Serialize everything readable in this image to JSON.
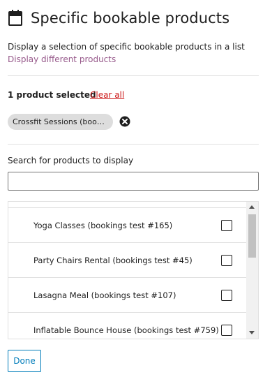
{
  "header": {
    "icon": "calendar-icon",
    "title": "Specific bookable products"
  },
  "description": "Display a selection of specific bookable products in a list",
  "change_link": "Display different products",
  "selection": {
    "count_label": "1 product selected",
    "clear_label": "Clear all",
    "tokens": [
      {
        "label": "Crossfit Sessions (bookin..."
      }
    ]
  },
  "search": {
    "label": "Search for products to display",
    "value": "",
    "placeholder": ""
  },
  "products": [
    {
      "label": "Yoga Classes (bookings test #165)",
      "checked": false
    },
    {
      "label": "Party Chairs Rental (bookings test #45)",
      "checked": false
    },
    {
      "label": "Lasagna Meal (bookings test #107)",
      "checked": false
    },
    {
      "label": "Inflatable Bounce House (bookings test #759)",
      "checked": false
    }
  ],
  "done_label": "Done",
  "colors": {
    "link": "#96588a",
    "clear": "#cc1818",
    "primary": "#007cba",
    "token_bg": "#dddddd"
  }
}
